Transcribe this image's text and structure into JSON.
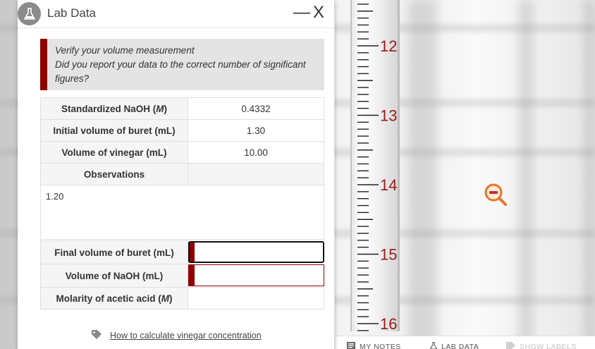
{
  "window": {
    "title": "Lab Data",
    "minimize": "—",
    "close": "X"
  },
  "alert": {
    "line1": "Verify your volume measurement",
    "line2": "Did you report your data to the correct number of significant figures?"
  },
  "rows": {
    "naoh_label": "Standardized NaOH (",
    "naoh_unit": "M",
    "naoh_value": "0.4332",
    "initial_label": "Initial volume of buret (mL)",
    "initial_value": "1.30",
    "vinegar_label": "Volume of vinegar (mL)",
    "vinegar_value": "10.00",
    "observations_label": "Observations",
    "observations_text": "1.20",
    "final_label": "Final volume of buret (mL)",
    "final_value": "",
    "vol_naoh_label": "Volume of NaOH (mL)",
    "vol_naoh_value": "",
    "molarity_label": "Molarity of acetic acid (",
    "molarity_unit": "M",
    "molarity_value": ""
  },
  "help": {
    "link_text": "How to calculate vinegar concentration"
  },
  "buret": {
    "marks": [
      "12",
      "13",
      "14",
      "15",
      "16"
    ]
  },
  "toolbar": {
    "notes": "MY NOTES",
    "lab_data": "LAB DATA",
    "show_labels": "SHOW LABELS"
  },
  "colors": {
    "accent": "#8e0000",
    "zoom_orange": "#e8752a",
    "mark_red": "#9b1b1b"
  }
}
